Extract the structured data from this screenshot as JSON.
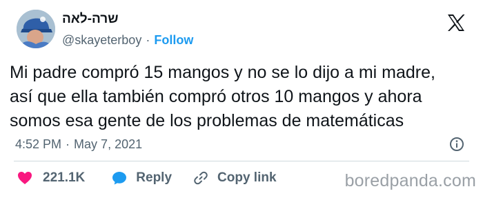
{
  "author": {
    "display_name": "שרה-לאה",
    "handle": "@skayeterboy",
    "separator": "·",
    "follow_label": "Follow"
  },
  "tweet": {
    "lines": [
      "Mi padre compró 15 mangos y no se lo dijo a mi madre,",
      "así que ella también compró otros 10 mangos y ahora",
      "somos esa gente de los problemas de matemáticas"
    ],
    "time": "4:52 PM",
    "separator": "·",
    "date": "May 7, 2021"
  },
  "actions": {
    "likes": "221.1K",
    "reply_label": "Reply",
    "copy_link_label": "Copy link"
  },
  "watermark": "boredpanda.com",
  "colors": {
    "accent": "#1d9bf0",
    "like": "#f91880",
    "muted": "#536471",
    "text": "#0f1419"
  },
  "icons": [
    "x-logo-icon",
    "info-icon",
    "heart-icon",
    "reply-bubble-icon",
    "link-icon"
  ]
}
